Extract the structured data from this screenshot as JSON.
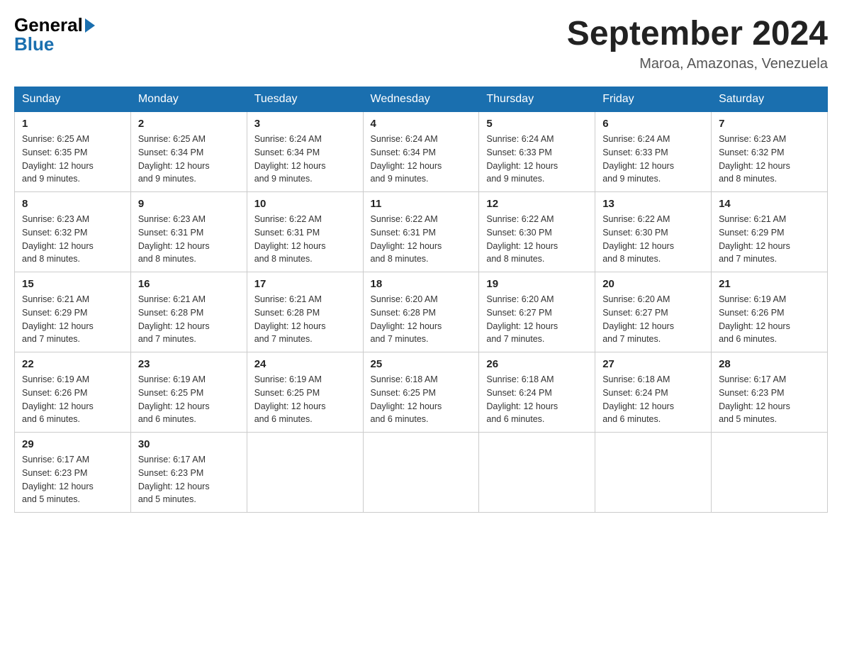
{
  "header": {
    "title": "September 2024",
    "location": "Maroa, Amazonas, Venezuela",
    "logo_general": "General",
    "logo_blue": "Blue"
  },
  "days_of_week": [
    "Sunday",
    "Monday",
    "Tuesday",
    "Wednesday",
    "Thursday",
    "Friday",
    "Saturday"
  ],
  "weeks": [
    [
      {
        "day": "1",
        "sunrise": "6:25 AM",
        "sunset": "6:35 PM",
        "daylight": "12 hours and 9 minutes."
      },
      {
        "day": "2",
        "sunrise": "6:25 AM",
        "sunset": "6:34 PM",
        "daylight": "12 hours and 9 minutes."
      },
      {
        "day": "3",
        "sunrise": "6:24 AM",
        "sunset": "6:34 PM",
        "daylight": "12 hours and 9 minutes."
      },
      {
        "day": "4",
        "sunrise": "6:24 AM",
        "sunset": "6:34 PM",
        "daylight": "12 hours and 9 minutes."
      },
      {
        "day": "5",
        "sunrise": "6:24 AM",
        "sunset": "6:33 PM",
        "daylight": "12 hours and 9 minutes."
      },
      {
        "day": "6",
        "sunrise": "6:24 AM",
        "sunset": "6:33 PM",
        "daylight": "12 hours and 9 minutes."
      },
      {
        "day": "7",
        "sunrise": "6:23 AM",
        "sunset": "6:32 PM",
        "daylight": "12 hours and 8 minutes."
      }
    ],
    [
      {
        "day": "8",
        "sunrise": "6:23 AM",
        "sunset": "6:32 PM",
        "daylight": "12 hours and 8 minutes."
      },
      {
        "day": "9",
        "sunrise": "6:23 AM",
        "sunset": "6:31 PM",
        "daylight": "12 hours and 8 minutes."
      },
      {
        "day": "10",
        "sunrise": "6:22 AM",
        "sunset": "6:31 PM",
        "daylight": "12 hours and 8 minutes."
      },
      {
        "day": "11",
        "sunrise": "6:22 AM",
        "sunset": "6:31 PM",
        "daylight": "12 hours and 8 minutes."
      },
      {
        "day": "12",
        "sunrise": "6:22 AM",
        "sunset": "6:30 PM",
        "daylight": "12 hours and 8 minutes."
      },
      {
        "day": "13",
        "sunrise": "6:22 AM",
        "sunset": "6:30 PM",
        "daylight": "12 hours and 8 minutes."
      },
      {
        "day": "14",
        "sunrise": "6:21 AM",
        "sunset": "6:29 PM",
        "daylight": "12 hours and 7 minutes."
      }
    ],
    [
      {
        "day": "15",
        "sunrise": "6:21 AM",
        "sunset": "6:29 PM",
        "daylight": "12 hours and 7 minutes."
      },
      {
        "day": "16",
        "sunrise": "6:21 AM",
        "sunset": "6:28 PM",
        "daylight": "12 hours and 7 minutes."
      },
      {
        "day": "17",
        "sunrise": "6:21 AM",
        "sunset": "6:28 PM",
        "daylight": "12 hours and 7 minutes."
      },
      {
        "day": "18",
        "sunrise": "6:20 AM",
        "sunset": "6:28 PM",
        "daylight": "12 hours and 7 minutes."
      },
      {
        "day": "19",
        "sunrise": "6:20 AM",
        "sunset": "6:27 PM",
        "daylight": "12 hours and 7 minutes."
      },
      {
        "day": "20",
        "sunrise": "6:20 AM",
        "sunset": "6:27 PM",
        "daylight": "12 hours and 7 minutes."
      },
      {
        "day": "21",
        "sunrise": "6:19 AM",
        "sunset": "6:26 PM",
        "daylight": "12 hours and 6 minutes."
      }
    ],
    [
      {
        "day": "22",
        "sunrise": "6:19 AM",
        "sunset": "6:26 PM",
        "daylight": "12 hours and 6 minutes."
      },
      {
        "day": "23",
        "sunrise": "6:19 AM",
        "sunset": "6:25 PM",
        "daylight": "12 hours and 6 minutes."
      },
      {
        "day": "24",
        "sunrise": "6:19 AM",
        "sunset": "6:25 PM",
        "daylight": "12 hours and 6 minutes."
      },
      {
        "day": "25",
        "sunrise": "6:18 AM",
        "sunset": "6:25 PM",
        "daylight": "12 hours and 6 minutes."
      },
      {
        "day": "26",
        "sunrise": "6:18 AM",
        "sunset": "6:24 PM",
        "daylight": "12 hours and 6 minutes."
      },
      {
        "day": "27",
        "sunrise": "6:18 AM",
        "sunset": "6:24 PM",
        "daylight": "12 hours and 6 minutes."
      },
      {
        "day": "28",
        "sunrise": "6:17 AM",
        "sunset": "6:23 PM",
        "daylight": "12 hours and 5 minutes."
      }
    ],
    [
      {
        "day": "29",
        "sunrise": "6:17 AM",
        "sunset": "6:23 PM",
        "daylight": "12 hours and 5 minutes."
      },
      {
        "day": "30",
        "sunrise": "6:17 AM",
        "sunset": "6:23 PM",
        "daylight": "12 hours and 5 minutes."
      },
      null,
      null,
      null,
      null,
      null
    ]
  ],
  "labels": {
    "sunrise": "Sunrise:",
    "sunset": "Sunset:",
    "daylight": "Daylight:"
  }
}
